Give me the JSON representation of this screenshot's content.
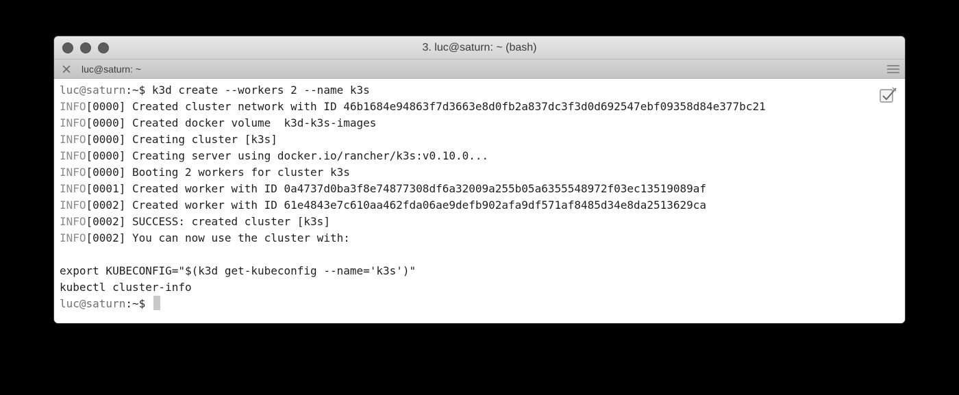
{
  "window": {
    "title": "3. luc@saturn: ~ (bash)"
  },
  "tab": {
    "title": "luc@saturn: ~"
  },
  "terminal": {
    "prompt_user": "luc@saturn",
    "prompt_suffix": ":~$ ",
    "command": "k3d create --workers 2 --name k3s",
    "log_lines": [
      {
        "level": "INFO",
        "time": "[0000]",
        "message": " Created cluster network with ID 46b1684e94863f7d3663e8d0fb2a837dc3f3d0d692547ebf09358d84e377bc21"
      },
      {
        "level": "INFO",
        "time": "[0000]",
        "message": " Created docker volume  k3d-k3s-images"
      },
      {
        "level": "INFO",
        "time": "[0000]",
        "message": " Creating cluster [k3s]"
      },
      {
        "level": "INFO",
        "time": "[0000]",
        "message": " Creating server using docker.io/rancher/k3s:v0.10.0..."
      },
      {
        "level": "INFO",
        "time": "[0000]",
        "message": " Booting 2 workers for cluster k3s"
      },
      {
        "level": "INFO",
        "time": "[0001]",
        "message": " Created worker with ID 0a4737d0ba3f8e74877308df6a32009a255b05a6355548972f03ec13519089af"
      },
      {
        "level": "INFO",
        "time": "[0002]",
        "message": " Created worker with ID 61e4843e7c610aa462fda06ae9defb902afa9df571af8485d34e8da2513629ca"
      },
      {
        "level": "INFO",
        "time": "[0002]",
        "message": " SUCCESS: created cluster [k3s]"
      },
      {
        "level": "INFO",
        "time": "[0002]",
        "message": " You can now use the cluster with:"
      }
    ],
    "instructions": [
      "export KUBECONFIG=\"$(k3d get-kubeconfig --name='k3s')\"",
      "kubectl cluster-info"
    ]
  },
  "icons": {
    "tab_close": "close-icon",
    "tab_menu": "menu-icon",
    "edit": "edit-icon"
  }
}
